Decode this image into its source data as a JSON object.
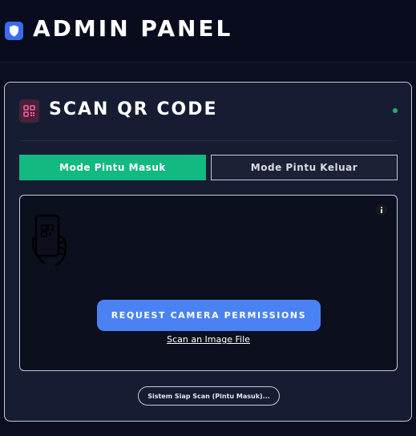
{
  "header": {
    "title": "ADMIN PANEL",
    "icon": "shield-icon",
    "accent": "#3b6cf0"
  },
  "card": {
    "title": "SCAN QR CODE",
    "icon": "qr-code-icon",
    "status_color": "#22b36a"
  },
  "modes": {
    "entry_label": "Mode Pintu Masuk",
    "exit_label": "Mode Pintu Keluar",
    "active": "entry",
    "active_color": "#12b981"
  },
  "scanner": {
    "camera_button_label": "REQUEST CAMERA PERMISSIONS",
    "scan_file_label": "Scan an Image File",
    "placeholder_icon": "phone-scan-icon",
    "info_icon": "info-icon"
  },
  "status": {
    "text": "Sistem Siap Scan (Pintu Masuk)..."
  }
}
